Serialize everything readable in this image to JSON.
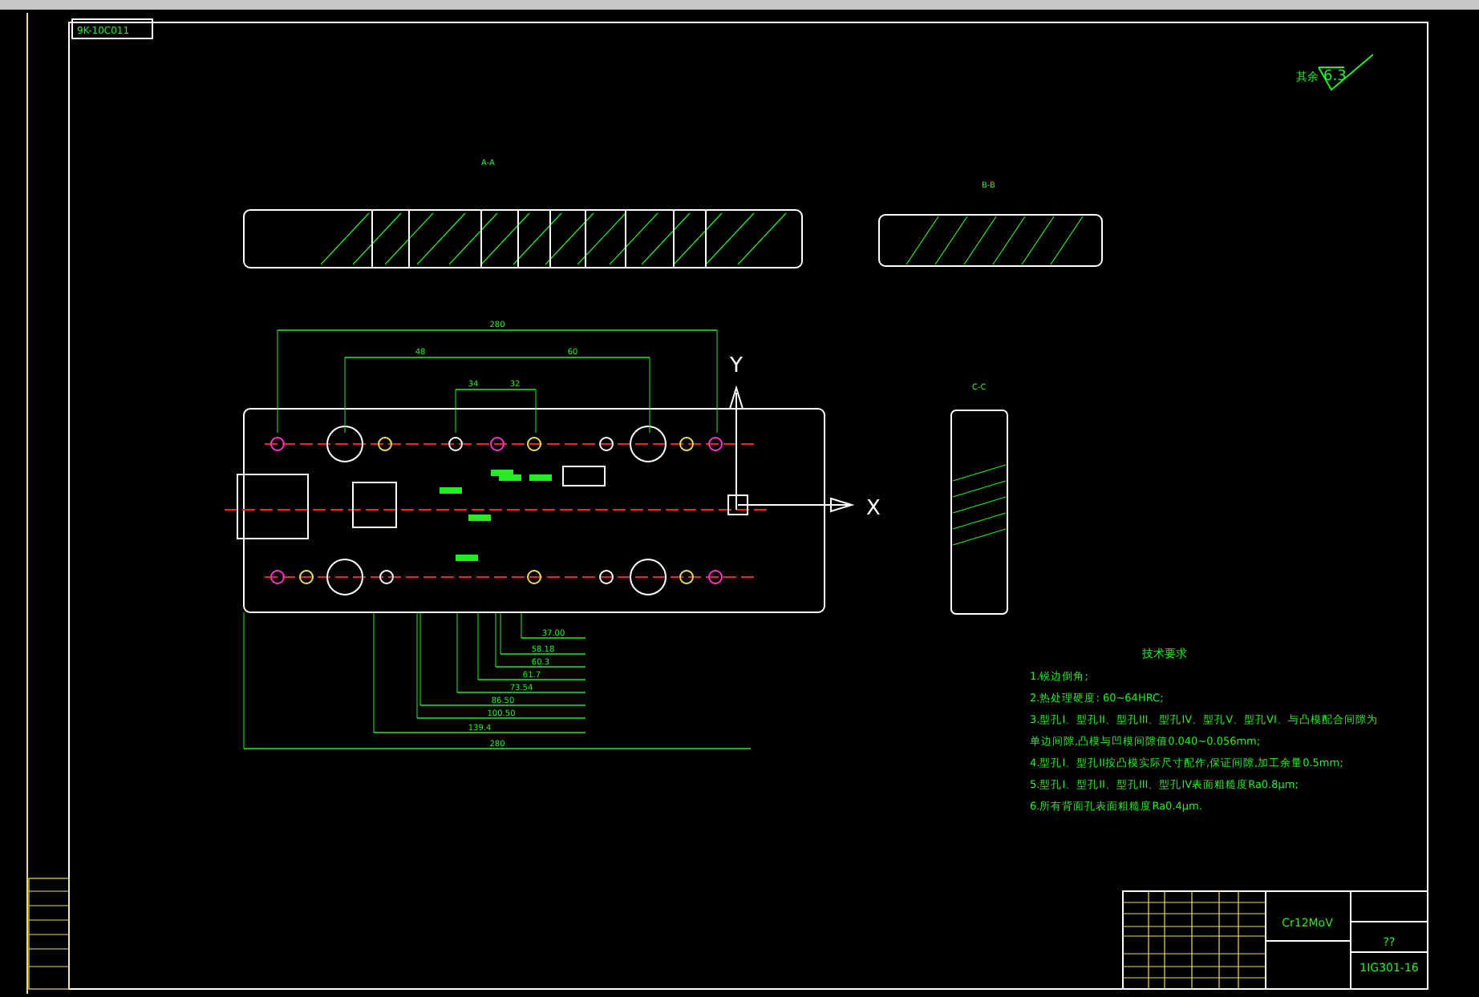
{
  "drawing_label": "9K-10C011",
  "surface_finish": {
    "note": "其余",
    "value": "6.3"
  },
  "views": [
    {
      "title": "A-A"
    },
    {
      "title": "B-B"
    },
    {
      "title": "C-C"
    }
  ],
  "axes": [
    {
      "label": "Y"
    },
    {
      "label": "X"
    }
  ],
  "dimensions_top": [
    {
      "label": "280"
    },
    {
      "label": "48"
    },
    {
      "label": "60"
    },
    {
      "label": "34"
    },
    {
      "label": "32"
    }
  ],
  "dimensions_bottom": [
    {
      "label": "37.00"
    },
    {
      "label": "58.18"
    },
    {
      "label": "60.3"
    },
    {
      "label": "61.7"
    },
    {
      "label": "73.54"
    },
    {
      "label": "86.50"
    },
    {
      "label": "100.50"
    },
    {
      "label": "139.4"
    },
    {
      "label": "280"
    }
  ],
  "notes": {
    "title": "技术要求",
    "items": [
      "1.锐边倒角;",
      "2.热处理硬度: 60~64HRC;",
      "3.型孔I、型孔II、型孔III、型孔IV、型孔V、型孔VI、与凸模配合间隙为",
      "单边间隙,凸模与凹模间隙值0.040~0.056mm;",
      "4.型孔I、型孔II按凸模实际尺寸配作,保证间隙,加工余量0.5mm;",
      "5.型孔I、型孔II、型孔III、型孔IV表面粗糙度Ra0.8μm;",
      "6.所有背面孔表面粗糙度Ra0.4μm."
    ]
  },
  "title_block": {
    "material": "Cr12MoV",
    "name": "??",
    "drawing_number": "1IG301-16"
  }
}
